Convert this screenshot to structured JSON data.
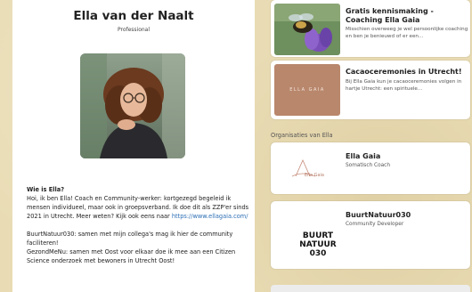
{
  "profile": {
    "name": "Ella van der Naalt",
    "role": "Professional",
    "bio_question": "Wie is Ella?",
    "bio_intro": "Hoi, ik ben Ella! Coach en Community-werker: kortgezegd begeleid ik mensen individueel, maar ook in groepsverband. Ik doe dit als ZZP'er sinds 2021 in Utrecht. Meer weten? Kijk ook eens naar ",
    "bio_link": "https://www.ellagaia.com/",
    "bio_line2": "BuurtNatuur030: samen met mijn collega's mag ik hier de community faciliteren!",
    "bio_line3": "GezondMeNu: samen met Oost voor elkaar doe ik mee aan een Citizen Science onderzoek met bewoners in Utrecht Oost!"
  },
  "offers": [
    {
      "title": "Gratis kennismaking - Coaching Ella Gaia",
      "description": "Misschien overweeg je wel persoonlijke coaching en ben je benieuwd of er een..."
    },
    {
      "title": "Cacaoceremonies in Utrecht!",
      "description": "Bij Ella Gaia kun je cacaoceremonies volgen in hartje Utrecht: een spirituele...",
      "thumb_text": "ELLA GAIA"
    }
  ],
  "organisations": {
    "heading": "Organisaties van Ella",
    "items": [
      {
        "name": "Ella Gaia",
        "role": "Somatisch Coach",
        "logo_text": "Ella Gaia"
      },
      {
        "name": "BuurtNatuur030",
        "role": "Community Developer",
        "logo_text": "BUURT NATUUR 030"
      }
    ]
  },
  "colors": {
    "link": "#2d6fb5",
    "cacao_thumb": "#b9876c",
    "logo_green": "#3c8d3a"
  }
}
